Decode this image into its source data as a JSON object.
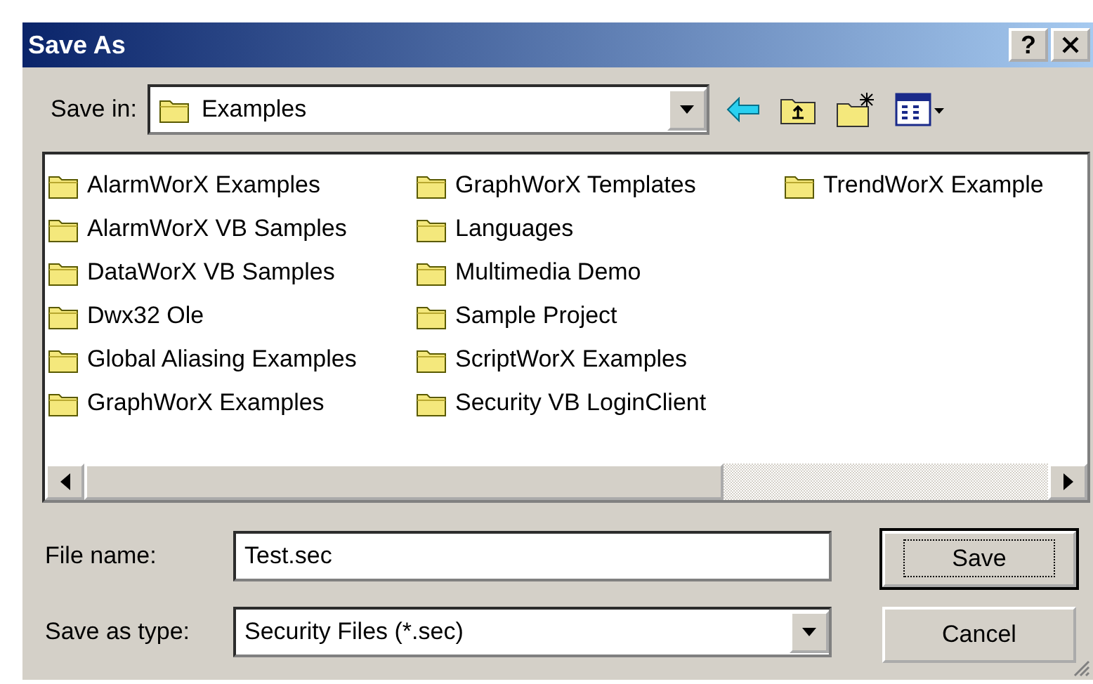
{
  "window": {
    "title": "Save As",
    "help_button": "?"
  },
  "save_in": {
    "label": "Save in:",
    "value": "Examples"
  },
  "files": [
    {
      "name": "AlarmWorX Examples"
    },
    {
      "name": "AlarmWorX VB Samples"
    },
    {
      "name": "DataWorX VB Samples"
    },
    {
      "name": "Dwx32 Ole"
    },
    {
      "name": "Global Aliasing Examples"
    },
    {
      "name": "GraphWorX Examples"
    },
    {
      "name": "GraphWorX Templates"
    },
    {
      "name": "Languages"
    },
    {
      "name": "Multimedia Demo"
    },
    {
      "name": "Sample Project"
    },
    {
      "name": "ScriptWorX Examples"
    },
    {
      "name": "Security VB LoginClient"
    },
    {
      "name": "TrendWorX Example"
    }
  ],
  "file_name": {
    "label": "File name:",
    "value": "Test.sec"
  },
  "save_as_type": {
    "label": "Save as type:",
    "value": "Security Files (*.sec)"
  },
  "buttons": [
    {
      "label": "Save",
      "default": true
    },
    {
      "label": "Cancel",
      "default": false
    }
  ]
}
